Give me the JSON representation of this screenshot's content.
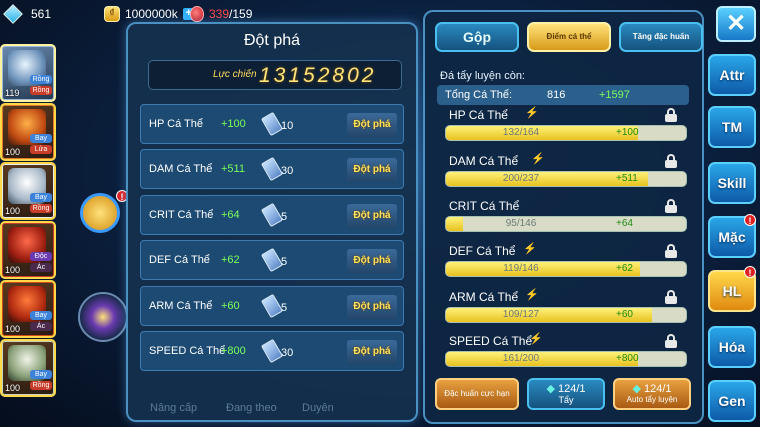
{
  "resources": {
    "gems": "561",
    "gold": "1000000k",
    "stamina_current": "339",
    "stamina_max": "/159"
  },
  "roster": {
    "slots": [
      {
        "level": "119",
        "tag1": "Rồng",
        "tag2": "Rồng",
        "color": "#9ab8d8"
      },
      {
        "level": "100",
        "tag1": "Bay",
        "tag2": "Lửa",
        "color": "#e0782a"
      },
      {
        "level": "100",
        "tag1": "Bay",
        "tag2": "Rồng",
        "color": "#e8eef4"
      },
      {
        "level": "100",
        "tag1": "Độc",
        "tag2": "Ác",
        "color": "#c83a2a"
      },
      {
        "level": "100",
        "tag1": "Bay",
        "tag2": "Ác",
        "color": "#d04a1a"
      },
      {
        "level": "100",
        "tag1": "Bay",
        "tag2": "Rồng",
        "color": "#c8d4c0"
      }
    ]
  },
  "center": {
    "title": "Đột phá",
    "power_label": "Lực chiến",
    "power_value": "13152802",
    "rows": [
      {
        "name": "HP Cá Thể",
        "bonus": "+100",
        "count": "10",
        "button": "Đột phá"
      },
      {
        "name": "DAM Cá Thể",
        "bonus": "+511",
        "count": "30",
        "button": "Đột phá"
      },
      {
        "name": "CRIT Cá Thể",
        "bonus": "+64",
        "count": "5",
        "button": "Đột phá"
      },
      {
        "name": "DEF Cá Thể",
        "bonus": "+62",
        "count": "5",
        "button": "Đột phá"
      },
      {
        "name": "ARM Cá Thể",
        "bonus": "+60",
        "count": "5",
        "button": "Đột phá"
      },
      {
        "name": "SPEED Cá Thể",
        "bonus": "+800",
        "count": "30",
        "button": "Đột phá"
      }
    ],
    "bottom": [
      "Nâng cấp",
      "Đang theo",
      "Duyên"
    ]
  },
  "right": {
    "tab_merge": "Gộp",
    "tab_points": "Điểm cá thể",
    "tab_special": "Tăng đặc huấn",
    "remaining_label": "Đá tẩy luyện còn:",
    "total_label": "Tổng Cá Thể:",
    "total_value": "816",
    "total_bonus": "+1597",
    "stats": [
      {
        "name": "HP Cá Thể",
        "value": "132/164",
        "add": "+100",
        "fill": 0.8,
        "yellow": true
      },
      {
        "name": "DAM Cá Thể",
        "value": "200/237",
        "add": "+511",
        "fill": 0.84,
        "yellow": true
      },
      {
        "name": "CRIT Cá Thể",
        "value": "95/146",
        "add": "+64",
        "fill": 0.07,
        "yellow": true
      },
      {
        "name": "DEF Cá Thể",
        "value": "119/146",
        "add": "+62",
        "fill": 0.81,
        "yellow": true
      },
      {
        "name": "ARM Cá Thể",
        "value": "109/127",
        "add": "+60",
        "fill": 0.86,
        "yellow": true
      },
      {
        "name": "SPEED Cá Thể",
        "value": "161/200",
        "add": "+800",
        "fill": 0.8,
        "yellow": true
      }
    ],
    "btn_special": "Đặc huấn cực hạn",
    "btn_wash_count": "124/1",
    "btn_wash_label": "Tẩy",
    "btn_auto_count": "124/1",
    "btn_auto_label": "Auto tẩy luyện"
  },
  "side_menu": [
    "Attr",
    "TM",
    "Skill",
    "Mặc",
    "HL",
    "Hóa",
    "Gen"
  ],
  "colors": {
    "accent": "#ffd84a",
    "panel": "#14304e",
    "positive": "#7aff5a"
  }
}
